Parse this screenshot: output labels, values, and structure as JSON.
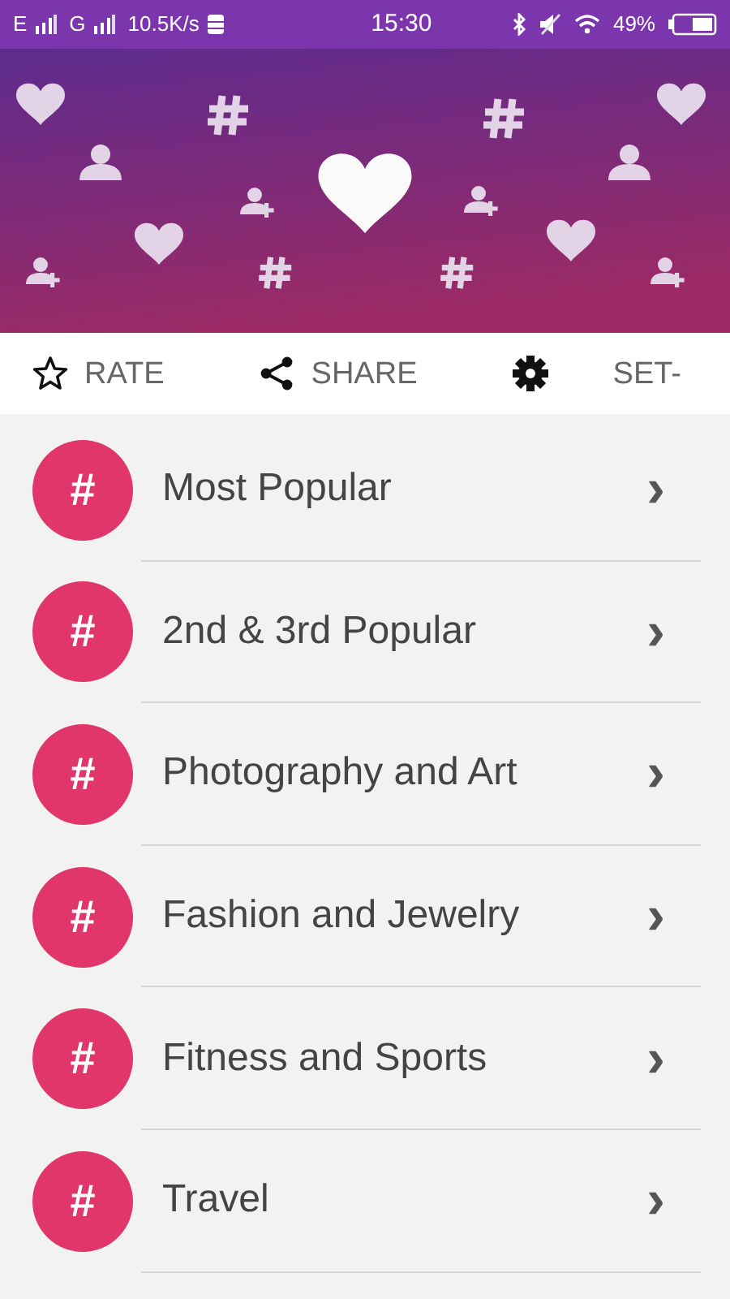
{
  "status_bar": {
    "network_1": "E",
    "network_2": "G",
    "speed": "10.5K/s",
    "time": "15:30",
    "battery": "49%"
  },
  "actions": [
    {
      "kind": "rate",
      "label": "RATE"
    },
    {
      "kind": "share",
      "label": "SHARE"
    },
    {
      "kind": "settings",
      "label": "SET-"
    }
  ],
  "categories": [
    {
      "icon": "#",
      "label": "Most Popular",
      "chevron": "›"
    },
    {
      "icon": "#",
      "label": "2nd & 3rd Popular",
      "chevron": "›"
    },
    {
      "icon": "#",
      "label": "Photography and Art",
      "chevron": "›"
    },
    {
      "icon": "#",
      "label": "Fashion and Jewelry",
      "chevron": "›"
    },
    {
      "icon": "#",
      "label": "Fitness and Sports",
      "chevron": "›"
    },
    {
      "icon": "#",
      "label": "Travel",
      "chevron": "›"
    }
  ]
}
